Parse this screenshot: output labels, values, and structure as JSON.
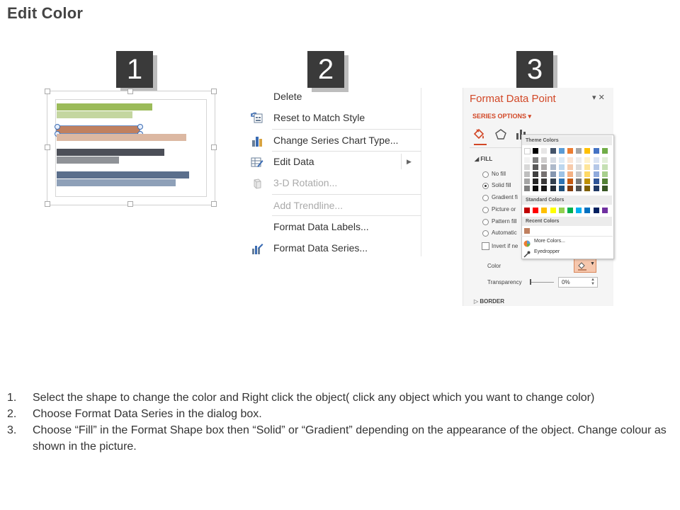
{
  "page": {
    "title": "Edit Color"
  },
  "badges": [
    "1",
    "2",
    "3"
  ],
  "panel1": {
    "bars": [
      {
        "color": "#9bbb59",
        "value": 0.69
      },
      {
        "color": "#c4d6a0",
        "value": 0.55
      },
      {
        "color": "#c0805f",
        "value": 0.6,
        "selected": true
      },
      {
        "color": "#dcb8a2",
        "value": 0.94
      },
      {
        "color": "#4c4f58",
        "value": 0.78
      },
      {
        "color": "#8f9297",
        "value": 0.45
      },
      {
        "color": "#5b6f8c",
        "value": 0.96
      },
      {
        "color": "#8ea0b8",
        "value": 0.86
      }
    ]
  },
  "menu": {
    "items": [
      {
        "label": "Delete",
        "icon": "none",
        "disabled": false
      },
      {
        "label": "Reset to Match Style",
        "icon": "reset-style-icon",
        "disabled": false
      },
      {
        "label": "Change Series Chart Type...",
        "icon": "bar-chart-icon",
        "disabled": false
      },
      {
        "label": "Edit Data",
        "icon": "table-edit-icon",
        "disabled": false,
        "submenu": true
      },
      {
        "label": "3-D Rotation...",
        "icon": "cube-icon",
        "disabled": true
      },
      {
        "label": "Add Trendline...",
        "icon": "none",
        "disabled": true
      },
      {
        "label": "Format Data Labels...",
        "icon": "none",
        "disabled": false
      },
      {
        "label": "Format Data Series...",
        "icon": "format-series-icon",
        "disabled": false
      }
    ],
    "submenu_arrow": "▶"
  },
  "pane": {
    "title": "Format Data Point",
    "controls": "▾ ✕",
    "series_options": "SERIES OPTIONS ▾",
    "fill_heading": "FILL",
    "fill_options": [
      {
        "label": "No fill",
        "checked": false
      },
      {
        "label": "Solid fill",
        "checked": true
      },
      {
        "label": "Gradient fi",
        "checked": false
      },
      {
        "label": "Picture or",
        "checked": false
      },
      {
        "label": "Pattern fill",
        "checked": false
      },
      {
        "label": "Automatic",
        "checked": false
      }
    ],
    "invert_label": "Invert if ne",
    "color_label": "Color",
    "transparency_label": "Transparency",
    "transparency_value": "0%",
    "border_heading": "BORDER",
    "accent_color": "#d24726"
  },
  "palette": {
    "theme_heading": "Theme Colors",
    "standard_heading": "Standard Colors",
    "recent_heading": "Recent Colors",
    "more_colors": "More Colors...",
    "eyedropper": "Eyedropper",
    "theme_top": [
      "#ffffff",
      "#000000",
      "#e7e6e6",
      "#44546a",
      "#5b9bd5",
      "#ed7d31",
      "#a5a5a5",
      "#ffc000",
      "#4472c4",
      "#70ad47"
    ],
    "theme_shades": [
      [
        "#f2f2f2",
        "#808080",
        "#d0cece",
        "#d6dce4",
        "#deebf6",
        "#fbe5d5",
        "#ededed",
        "#fff2cc",
        "#dae3f3",
        "#e2efd9"
      ],
      [
        "#d8d8d8",
        "#595959",
        "#aeabab",
        "#adb9ca",
        "#bdd7ee",
        "#f7cbac",
        "#dbdbdb",
        "#fee599",
        "#b4c7e7",
        "#c5e0b3"
      ],
      [
        "#bfbfbf",
        "#3f3f3f",
        "#757070",
        "#8496b0",
        "#9dc3e6",
        "#f4b183",
        "#c9c9c9",
        "#ffd965",
        "#8faadc",
        "#a8d08d"
      ],
      [
        "#a5a5a5",
        "#262626",
        "#3a3838",
        "#323f4f",
        "#2e75b5",
        "#c55a11",
        "#7b7b7b",
        "#bf9000",
        "#2f5597",
        "#538135"
      ],
      [
        "#7f7f7f",
        "#0c0c0c",
        "#171616",
        "#222a35",
        "#1e4e79",
        "#843c0b",
        "#525252",
        "#7f6000",
        "#1f3864",
        "#375623"
      ]
    ],
    "standard": [
      "#c00000",
      "#ff0000",
      "#ffc000",
      "#ffff00",
      "#92d050",
      "#00b050",
      "#00b0f0",
      "#0070c0",
      "#002060",
      "#7030a0"
    ],
    "recent": [
      "#c0805f"
    ]
  },
  "instructions": [
    {
      "num": "1.",
      "text": "Select the shape to change the color and Right click the object( click any object which you want to change color)"
    },
    {
      "num": "2.",
      "text": "Choose Format Data Series in the dialog box."
    },
    {
      "num": "3.",
      "text": "Choose “Fill” in the Format Shape box then “Solid” or “Gradient” depending on the appearance of the object. Change colour as shown in the picture."
    }
  ]
}
